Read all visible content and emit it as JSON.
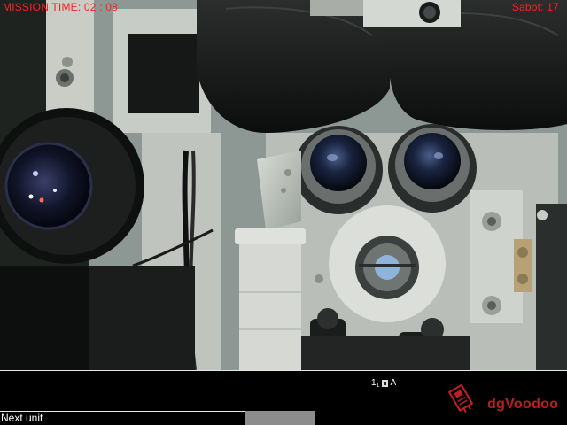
{
  "hud": {
    "mission_time": "MISSION TIME: 02 : 08",
    "ammo": "Sabot: 17"
  },
  "console": {
    "command_text": "Next unit",
    "unit_number": "1",
    "unit_sub": "1",
    "unit_letter": "A"
  },
  "logo": {
    "text": "dgVoodoo",
    "icon": "dgvoodoo-logo-icon"
  },
  "colors": {
    "hud_text": "#ff2020",
    "logo": "#b82020",
    "panel_border": "#e8e8e8"
  }
}
